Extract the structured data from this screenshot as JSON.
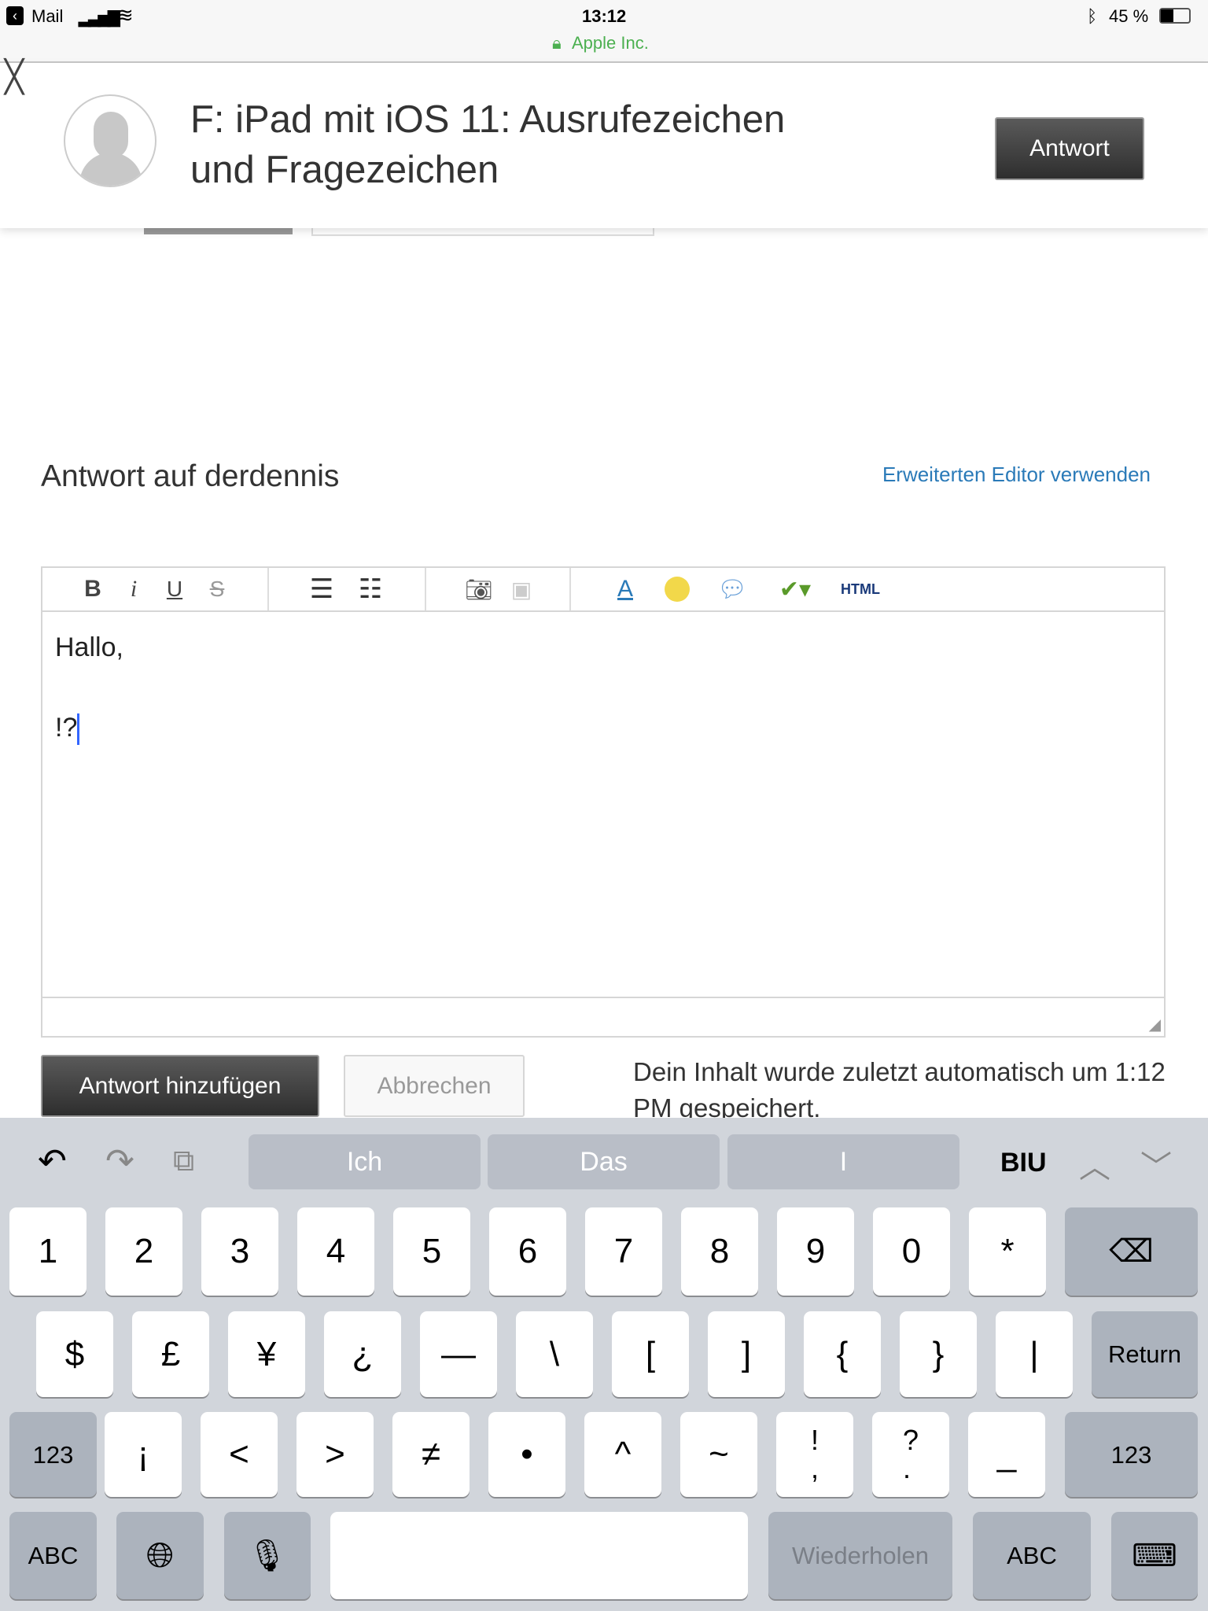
{
  "status_bar": {
    "back_app": "Mail",
    "time": "13:12",
    "site": "Apple Inc.",
    "battery": "45 %"
  },
  "header": {
    "title": "F: iPad mit iOS 11: Ausrufezeichen und Fragezeichen",
    "reply_button": "Antwort"
  },
  "reply": {
    "heading": "Antwort auf derdennis",
    "advanced_editor_link": "Erweiterten Editor verwenden"
  },
  "editor": {
    "toolbar": {
      "bold": "B",
      "italic": "i",
      "underline": "U",
      "strike": "S",
      "html": "HTML"
    },
    "lines": [
      "Hallo,",
      "!?"
    ]
  },
  "actions": {
    "submit": "Antwort hinzufügen",
    "cancel": "Abbrechen",
    "autosave": "Dein Inhalt wurde zuletzt automatisch um 1:12 PM gespeichert."
  },
  "keyboard": {
    "suggestions": [
      "Ich",
      "Das",
      "I"
    ],
    "format": "BIU",
    "row1": [
      "1",
      "2",
      "3",
      "4",
      "5",
      "6",
      "7",
      "8",
      "9",
      "0",
      "*"
    ],
    "row2": [
      "$",
      "£",
      "¥",
      "¿",
      "—",
      "\\",
      "[",
      "]",
      "{",
      "}",
      "|"
    ],
    "return": "Return",
    "row3": [
      "¡",
      "<",
      ">",
      "≠",
      "•",
      "^",
      "~",
      "!\n,",
      "?\n.",
      "_"
    ],
    "mode_left": "123",
    "mode_right": "123",
    "abc_left": "ABC",
    "abc_right": "ABC",
    "redo": "Wiederholen"
  },
  "colors": {
    "link": "#2a7ab8",
    "secure": "#4cb050",
    "cursor": "#3366ff"
  }
}
